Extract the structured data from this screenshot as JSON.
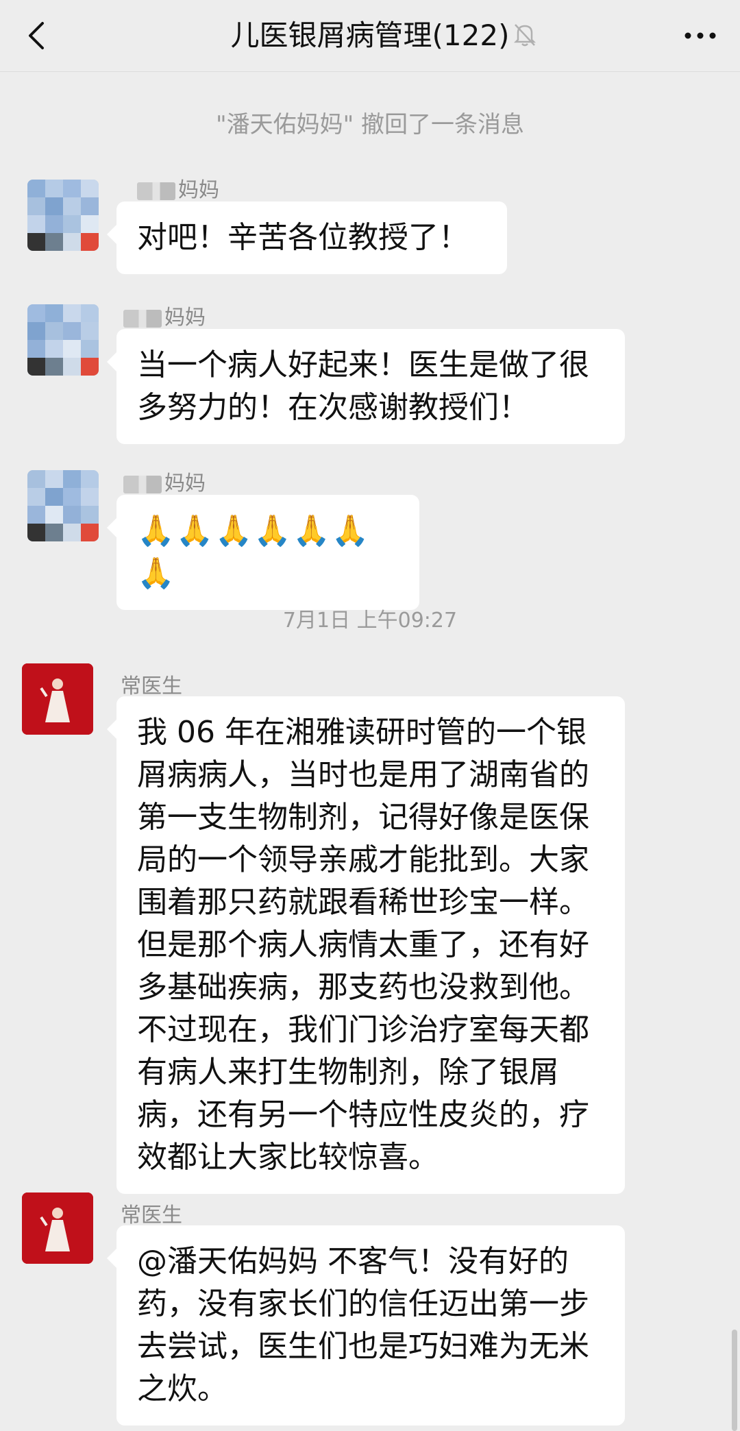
{
  "header": {
    "title": "儿医银屑病管理(122)",
    "back_icon": "chevron-left-icon",
    "mute_icon": "bell-off-icon",
    "more_icon": "ellipsis-icon"
  },
  "system_message": "\"潘天佑妈妈\" 撤回了一条消息",
  "messages": [
    {
      "sender": "妈妈",
      "text": "对吧！辛苦各位教授了！"
    },
    {
      "sender": "妈妈",
      "text": "当一个病人好起来！医生是做了很多努力的！在次感谢教授们！"
    },
    {
      "sender": "妈妈",
      "text": "🙏🙏🙏🙏🙏🙏🙏"
    },
    {
      "sender": "常医生",
      "text": "我 06 年在湘雅读研时管的一个银屑病病人，当时也是用了湖南省的第一支生物制剂，记得好像是医保局的一个领导亲戚才能批到。大家围着那只药就跟看稀世珍宝一样。但是那个病人病情太重了，还有好多基础疾病，那支药也没救到他。不过现在，我们门诊治疗室每天都有病人来打生物制剂，除了银屑病，还有另一个特应性皮炎的，疗效都让大家比较惊喜。"
    },
    {
      "sender": "常医生",
      "text": "@潘天佑妈妈  不客气！没有好的药，没有家长们的信任迈出第一步去尝试，医生们也是巧妇难为无米之炊。"
    }
  ],
  "timestamp": "7月1日 上午09:27"
}
